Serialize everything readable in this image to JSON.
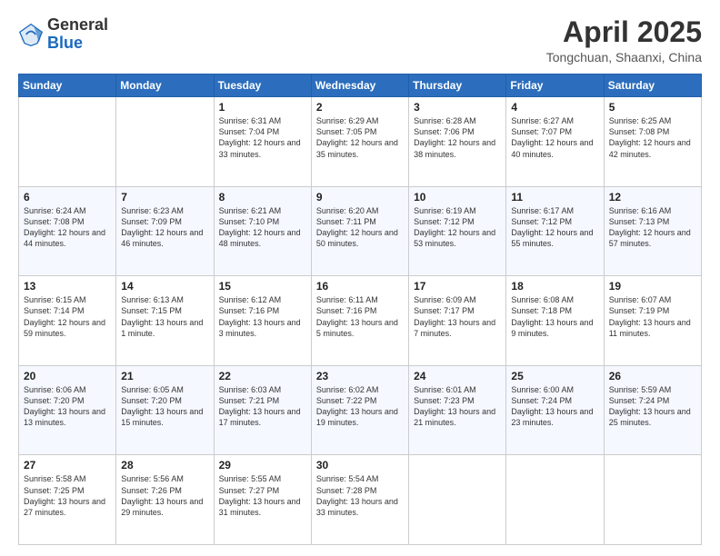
{
  "header": {
    "logo_general": "General",
    "logo_blue": "Blue",
    "title": "April 2025",
    "subtitle": "Tongchuan, Shaanxi, China"
  },
  "days_of_week": [
    "Sunday",
    "Monday",
    "Tuesday",
    "Wednesday",
    "Thursday",
    "Friday",
    "Saturday"
  ],
  "weeks": [
    [
      {
        "day": "",
        "info": ""
      },
      {
        "day": "",
        "info": ""
      },
      {
        "day": "1",
        "info": "Sunrise: 6:31 AM\nSunset: 7:04 PM\nDaylight: 12 hours and 33 minutes."
      },
      {
        "day": "2",
        "info": "Sunrise: 6:29 AM\nSunset: 7:05 PM\nDaylight: 12 hours and 35 minutes."
      },
      {
        "day": "3",
        "info": "Sunrise: 6:28 AM\nSunset: 7:06 PM\nDaylight: 12 hours and 38 minutes."
      },
      {
        "day": "4",
        "info": "Sunrise: 6:27 AM\nSunset: 7:07 PM\nDaylight: 12 hours and 40 minutes."
      },
      {
        "day": "5",
        "info": "Sunrise: 6:25 AM\nSunset: 7:08 PM\nDaylight: 12 hours and 42 minutes."
      }
    ],
    [
      {
        "day": "6",
        "info": "Sunrise: 6:24 AM\nSunset: 7:08 PM\nDaylight: 12 hours and 44 minutes."
      },
      {
        "day": "7",
        "info": "Sunrise: 6:23 AM\nSunset: 7:09 PM\nDaylight: 12 hours and 46 minutes."
      },
      {
        "day": "8",
        "info": "Sunrise: 6:21 AM\nSunset: 7:10 PM\nDaylight: 12 hours and 48 minutes."
      },
      {
        "day": "9",
        "info": "Sunrise: 6:20 AM\nSunset: 7:11 PM\nDaylight: 12 hours and 50 minutes."
      },
      {
        "day": "10",
        "info": "Sunrise: 6:19 AM\nSunset: 7:12 PM\nDaylight: 12 hours and 53 minutes."
      },
      {
        "day": "11",
        "info": "Sunrise: 6:17 AM\nSunset: 7:12 PM\nDaylight: 12 hours and 55 minutes."
      },
      {
        "day": "12",
        "info": "Sunrise: 6:16 AM\nSunset: 7:13 PM\nDaylight: 12 hours and 57 minutes."
      }
    ],
    [
      {
        "day": "13",
        "info": "Sunrise: 6:15 AM\nSunset: 7:14 PM\nDaylight: 12 hours and 59 minutes."
      },
      {
        "day": "14",
        "info": "Sunrise: 6:13 AM\nSunset: 7:15 PM\nDaylight: 13 hours and 1 minute."
      },
      {
        "day": "15",
        "info": "Sunrise: 6:12 AM\nSunset: 7:16 PM\nDaylight: 13 hours and 3 minutes."
      },
      {
        "day": "16",
        "info": "Sunrise: 6:11 AM\nSunset: 7:16 PM\nDaylight: 13 hours and 5 minutes."
      },
      {
        "day": "17",
        "info": "Sunrise: 6:09 AM\nSunset: 7:17 PM\nDaylight: 13 hours and 7 minutes."
      },
      {
        "day": "18",
        "info": "Sunrise: 6:08 AM\nSunset: 7:18 PM\nDaylight: 13 hours and 9 minutes."
      },
      {
        "day": "19",
        "info": "Sunrise: 6:07 AM\nSunset: 7:19 PM\nDaylight: 13 hours and 11 minutes."
      }
    ],
    [
      {
        "day": "20",
        "info": "Sunrise: 6:06 AM\nSunset: 7:20 PM\nDaylight: 13 hours and 13 minutes."
      },
      {
        "day": "21",
        "info": "Sunrise: 6:05 AM\nSunset: 7:20 PM\nDaylight: 13 hours and 15 minutes."
      },
      {
        "day": "22",
        "info": "Sunrise: 6:03 AM\nSunset: 7:21 PM\nDaylight: 13 hours and 17 minutes."
      },
      {
        "day": "23",
        "info": "Sunrise: 6:02 AM\nSunset: 7:22 PM\nDaylight: 13 hours and 19 minutes."
      },
      {
        "day": "24",
        "info": "Sunrise: 6:01 AM\nSunset: 7:23 PM\nDaylight: 13 hours and 21 minutes."
      },
      {
        "day": "25",
        "info": "Sunrise: 6:00 AM\nSunset: 7:24 PM\nDaylight: 13 hours and 23 minutes."
      },
      {
        "day": "26",
        "info": "Sunrise: 5:59 AM\nSunset: 7:24 PM\nDaylight: 13 hours and 25 minutes."
      }
    ],
    [
      {
        "day": "27",
        "info": "Sunrise: 5:58 AM\nSunset: 7:25 PM\nDaylight: 13 hours and 27 minutes."
      },
      {
        "day": "28",
        "info": "Sunrise: 5:56 AM\nSunset: 7:26 PM\nDaylight: 13 hours and 29 minutes."
      },
      {
        "day": "29",
        "info": "Sunrise: 5:55 AM\nSunset: 7:27 PM\nDaylight: 13 hours and 31 minutes."
      },
      {
        "day": "30",
        "info": "Sunrise: 5:54 AM\nSunset: 7:28 PM\nDaylight: 13 hours and 33 minutes."
      },
      {
        "day": "",
        "info": ""
      },
      {
        "day": "",
        "info": ""
      },
      {
        "day": "",
        "info": ""
      }
    ]
  ]
}
